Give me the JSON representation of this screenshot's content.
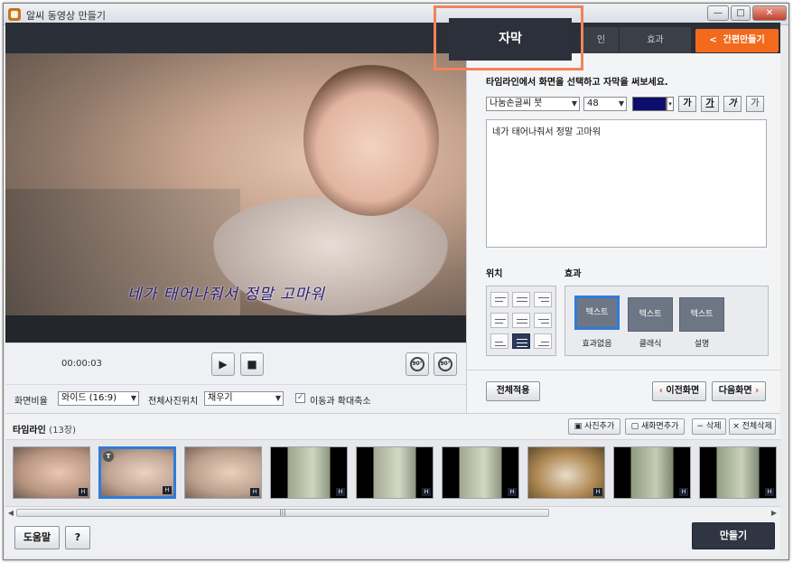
{
  "window": {
    "title": "알씨 동영상 만들기",
    "minimize": "—",
    "maximize": "□",
    "close": "✕"
  },
  "tabs": [
    {
      "label": "자막",
      "active": true
    },
    {
      "label": "인",
      "active": false
    },
    {
      "label": "효과",
      "active": false
    }
  ],
  "quick_make_button": {
    "icon": "<",
    "label": "간편만들기"
  },
  "player": {
    "caption_overlay": "네가 태어나줘서 정말 고마워",
    "time": "00:00:03",
    "play_icon": "▶",
    "stop_icon": "■",
    "rotate_left_label": "90°",
    "rotate_right_label": "90°"
  },
  "settings": {
    "aspect_label": "화면비율",
    "aspect_value": "와이드 (16:9)",
    "photo_pos_label": "전체사진위치",
    "photo_pos_value": "채우기",
    "motion_checkbox_label": "이동과 확대축소",
    "motion_checked": true
  },
  "subtitle_panel": {
    "instruction": "타임라인에서 화면을 선택하고 자막을 써보세요.",
    "font_name": "나눔손글씨 붓",
    "font_size": "48",
    "text_color": "#0d0d6e",
    "format_buttons": [
      "가",
      "가",
      "가",
      "가"
    ],
    "text": "네가 태어나줘서 정말 고마워",
    "position_label": "위치",
    "effect_label": "효과",
    "effects": [
      {
        "thumb_text": "텍스트",
        "label": "효과없음",
        "selected": true
      },
      {
        "thumb_text": "텍스트",
        "label": "클래식",
        "selected": false
      },
      {
        "thumb_text": "텍스트",
        "label": "설명",
        "selected": false
      }
    ],
    "apply_all_button": "전체적용",
    "prev_button": "이전화면",
    "next_button": "다음화면"
  },
  "timeline": {
    "title": "타임라인",
    "count": "(13장)",
    "add_photo_button": "사진추가",
    "add_new_screen_button": "새화면추가",
    "delete_button": "삭제",
    "delete_all_button": "전체삭제",
    "thumb_badge": "T",
    "thumb_h": "H",
    "scroll_grip": "|||"
  },
  "footer": {
    "help_button": "도움말",
    "question_button": "?",
    "make_button": "만들기"
  },
  "colors": {
    "accent_orange": "#f36a1d",
    "selection_blue": "#2f7cd9",
    "dark_bar": "#2b2f37"
  }
}
